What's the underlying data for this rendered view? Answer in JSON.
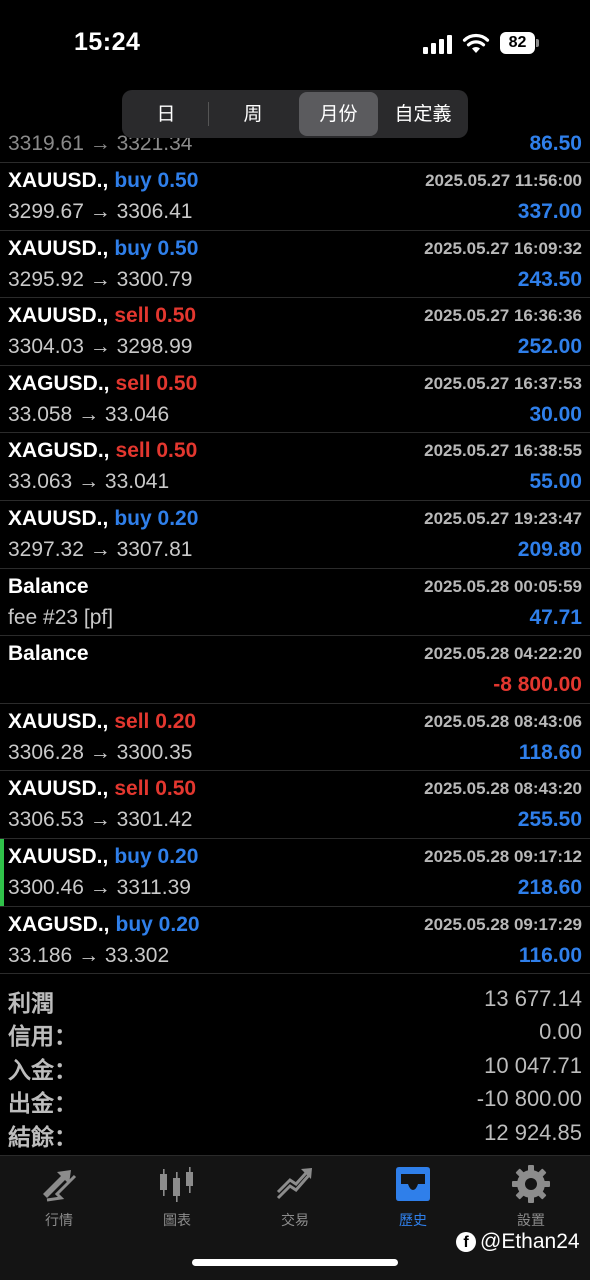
{
  "status": {
    "time": "15:24",
    "battery": "82"
  },
  "segments": [
    "日",
    "周",
    "月份",
    "自定義"
  ],
  "active_segment": 2,
  "partial_row": {
    "price": "3319.61 → 3321.34",
    "amount": "86.50"
  },
  "rows": [
    {
      "symbol": "XAUUSD.,",
      "side": "buy",
      "volume": "buy 0.50",
      "date": "2025.05.27 11:56:00",
      "price": "3299.67 → 3306.41",
      "amount": "337.00",
      "sign": "pos"
    },
    {
      "symbol": "XAUUSD.,",
      "side": "buy",
      "volume": "buy 0.50",
      "date": "2025.05.27 16:09:32",
      "price": "3295.92 → 3300.79",
      "amount": "243.50",
      "sign": "pos"
    },
    {
      "symbol": "XAUUSD.,",
      "side": "sell",
      "volume": "sell 0.50",
      "date": "2025.05.27 16:36:36",
      "price": "3304.03 → 3298.99",
      "amount": "252.00",
      "sign": "pos"
    },
    {
      "symbol": "XAGUSD.,",
      "side": "sell",
      "volume": "sell 0.50",
      "date": "2025.05.27 16:37:53",
      "price": "33.058 → 33.046",
      "amount": "30.00",
      "sign": "pos"
    },
    {
      "symbol": "XAGUSD.,",
      "side": "sell",
      "volume": "sell 0.50",
      "date": "2025.05.27 16:38:55",
      "price": "33.063 → 33.041",
      "amount": "55.00",
      "sign": "pos"
    },
    {
      "symbol": "XAUUSD.,",
      "side": "buy",
      "volume": "buy 0.20",
      "date": "2025.05.27 19:23:47",
      "price": "3297.32 → 3307.81",
      "amount": "209.80",
      "sign": "pos"
    },
    {
      "symbol": "Balance",
      "side": "",
      "volume": "",
      "date": "2025.05.28 00:05:59",
      "price": "fee #23 [pf]",
      "amount": "47.71",
      "sign": "pos"
    },
    {
      "symbol": "Balance",
      "side": "",
      "volume": "",
      "date": "2025.05.28 04:22:20",
      "price": "",
      "amount": "-8 800.00",
      "sign": "neg"
    },
    {
      "symbol": "XAUUSD.,",
      "side": "sell",
      "volume": "sell 0.20",
      "date": "2025.05.28 08:43:06",
      "price": "3306.28 → 3300.35",
      "amount": "118.60",
      "sign": "pos"
    },
    {
      "symbol": "XAUUSD.,",
      "side": "sell",
      "volume": "sell 0.50",
      "date": "2025.05.28 08:43:20",
      "price": "3306.53 → 3301.42",
      "amount": "255.50",
      "sign": "pos"
    },
    {
      "symbol": "XAUUSD.,",
      "side": "buy",
      "volume": "buy 0.20",
      "date": "2025.05.28 09:17:12",
      "price": "3300.46 → 3311.39",
      "amount": "218.60",
      "sign": "pos",
      "selected": true
    },
    {
      "symbol": "XAGUSD.,",
      "side": "buy",
      "volume": "buy 0.20",
      "date": "2025.05.28 09:17:29",
      "price": "33.186 → 33.302",
      "amount": "116.00",
      "sign": "pos"
    }
  ],
  "summary": [
    {
      "label": "利潤",
      "value": "13 677.14"
    },
    {
      "label": "信用：",
      "value": "0.00"
    },
    {
      "label": "入金：",
      "value": "10 047.71"
    },
    {
      "label": "出金：",
      "value": "-10 800.00"
    },
    {
      "label": "結餘：",
      "value": "12 924.85"
    }
  ],
  "tabs": [
    {
      "label": "行情",
      "icon": "quotes-icon"
    },
    {
      "label": "圖表",
      "icon": "chart-icon"
    },
    {
      "label": "交易",
      "icon": "trade-icon"
    },
    {
      "label": "歷史",
      "icon": "history-icon"
    },
    {
      "label": "設置",
      "icon": "settings-icon"
    }
  ],
  "active_tab": 3,
  "watermark": "@Ethan24",
  "colors": {
    "buy": "#2f7fea",
    "sell": "#e3372f",
    "positive": "#2f7fea",
    "negative": "#e3372f",
    "accent": "#2f7fea"
  }
}
